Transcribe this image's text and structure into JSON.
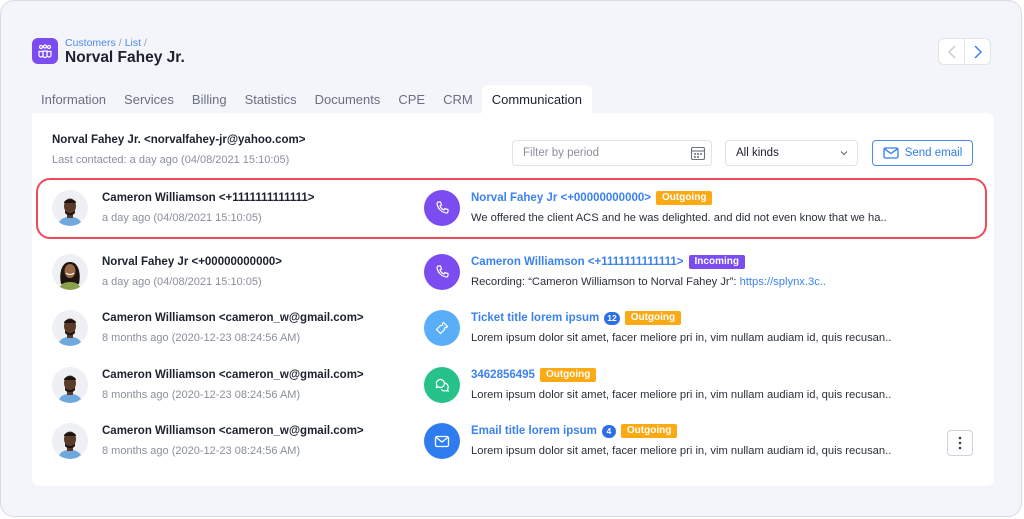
{
  "header": {
    "breadcrumb": [
      {
        "label": "Customers"
      },
      {
        "label": "List"
      }
    ],
    "breadcrumb_separator": "/",
    "title": "Norval Fahey Jr.",
    "app_icon": "customers-group-icon",
    "nav": {
      "prev_icon": "chevron-left-icon",
      "next_icon": "chevron-right-icon"
    }
  },
  "tabs": [
    {
      "label": "Information",
      "active": false
    },
    {
      "label": "Services",
      "active": false
    },
    {
      "label": "Billing",
      "active": false
    },
    {
      "label": "Statistics",
      "active": false
    },
    {
      "label": "Documents",
      "active": false
    },
    {
      "label": "CPE",
      "active": false
    },
    {
      "label": "CRM",
      "active": false
    },
    {
      "label": "Communication",
      "active": true
    }
  ],
  "communication": {
    "contact": "Norval Fahey Jr. <norvalfahey-jr@yahoo.com>",
    "last_contacted": "Last contacted: a day ago (04/08/2021  15:10:05)",
    "filter": {
      "placeholder": "Filter by period",
      "value": ""
    },
    "kind_select": {
      "value": "All kinds"
    },
    "send_email_label": "Send email",
    "items": [
      {
        "person": "Cameron Williamson <+1111111111111>",
        "time": "a day ago (04/08/2021  15:10:05)",
        "avatar": "man",
        "type": "call",
        "title": "Norval Fahey Jr <+00000000000>",
        "count": null,
        "direction": "Outgoing",
        "body": "We offered the client ACS and he was delighted. and did not even know that we ha..",
        "link": null,
        "highlighted": true
      },
      {
        "person": "Norval Fahey Jr <+00000000000>",
        "time": "a day ago (04/08/2021  15:10:05)",
        "avatar": "woman",
        "type": "call",
        "title": "Cameron Williamson <+1111111111111>",
        "count": null,
        "direction": "Incoming",
        "body": "Recording: “Cameron Williamson to Norval Fahey Jr”: ",
        "link": "https://splynx.3c..",
        "highlighted": false
      },
      {
        "person": "Cameron Williamson <cameron_w@gmail.com>",
        "time": "8 months ago (2020-12-23  08:24:56 AM)",
        "avatar": "man",
        "type": "ticket",
        "title": "Ticket title lorem ipsum",
        "count": "12",
        "direction": "Outgoing",
        "body": "Lorem ipsum dolor sit amet, facer meliore pri in, vim nullam audiam id, quis recusan..",
        "link": null,
        "highlighted": false
      },
      {
        "person": "Cameron Williamson <cameron_w@gmail.com>",
        "time": "8 months ago (2020-12-23  08:24:56 AM)",
        "avatar": "man",
        "type": "chat",
        "title": "3462856495",
        "count": null,
        "direction": "Outgoing",
        "body": "Lorem ipsum dolor sit amet, facer meliore pri in, vim nullam audiam id, quis recusan..",
        "link": null,
        "highlighted": false
      },
      {
        "person": "Cameron Williamson <cameron_w@gmail.com>",
        "time": "8 months ago (2020-12-23  08:24:56 AM)",
        "avatar": "man",
        "type": "email",
        "title": "Email title lorem ipsum",
        "count": "4",
        "direction": "Outgoing",
        "body": "Lorem ipsum dolor sit amet, facer meliore pri in, vim nullam audiam id, quis recusan..",
        "link": null,
        "highlighted": false
      }
    ]
  },
  "colors": {
    "accent_blue": "#3b82f0",
    "purple": "#7b4cf0",
    "outgoing": "#fbaa14",
    "incoming": "#7b4cf0",
    "ticket": "#5aaef7",
    "chat": "#27c28a",
    "email": "#2f7cf0",
    "highlight_border": "#ef4a5a"
  }
}
